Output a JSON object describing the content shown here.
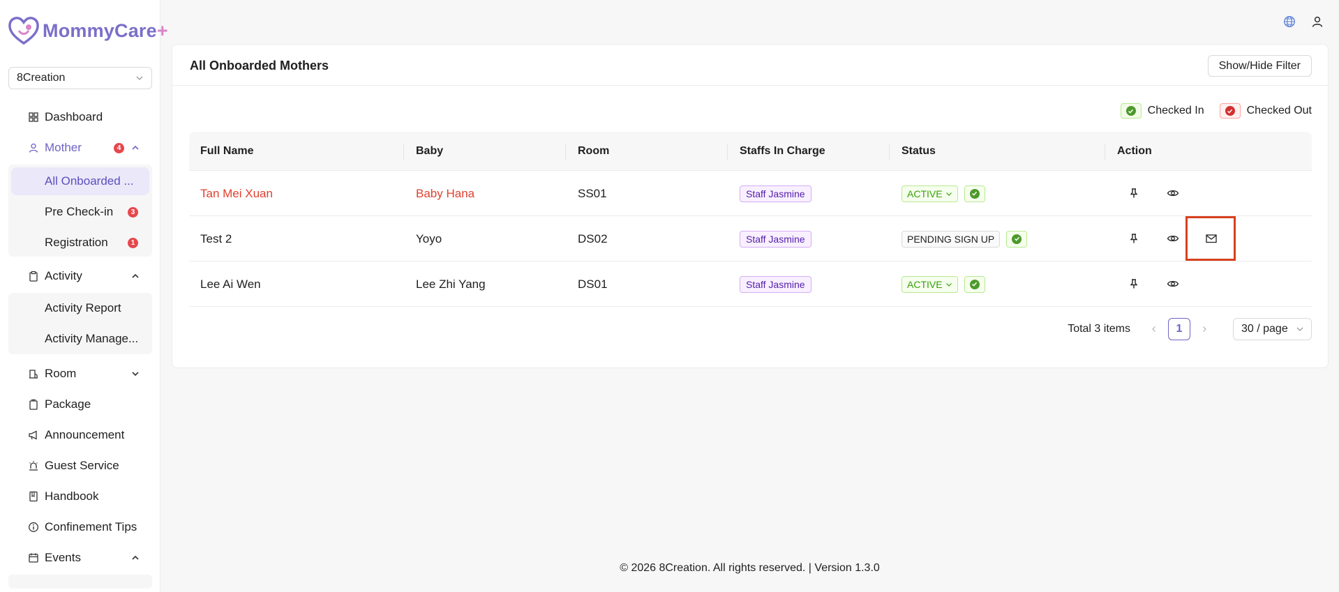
{
  "app": {
    "name": "MommyCare",
    "name_suffix": "+",
    "accent": "#6f64c4"
  },
  "org_select": {
    "value": "8Creation"
  },
  "sidebar": {
    "dashboard": "Dashboard",
    "mother": {
      "label": "Mother",
      "badge": "4"
    },
    "mother_items": [
      {
        "label": "All Onboarded ...",
        "badge": ""
      },
      {
        "label": "Pre Check-in",
        "badge": "3"
      },
      {
        "label": "Registration",
        "badge": "1"
      }
    ],
    "activity": {
      "label": "Activity"
    },
    "activity_items": [
      {
        "label": "Activity Report"
      },
      {
        "label": "Activity Manage..."
      }
    ],
    "room": "Room",
    "package": "Package",
    "announcement": "Announcement",
    "guest_service": "Guest Service",
    "handbook": "Handbook",
    "confinement_tips": "Confinement Tips",
    "events": "Events"
  },
  "card": {
    "title": "All Onboarded Mothers",
    "filter_button": "Show/Hide Filter",
    "legend": {
      "checked_in": "Checked In",
      "checked_out": "Checked Out"
    }
  },
  "table": {
    "columns": [
      "Full Name",
      "Baby",
      "Room",
      "Staffs In Charge",
      "Status",
      "Action"
    ],
    "rows": [
      {
        "name": "Tan Mei Xuan",
        "baby": "Baby Hana",
        "room": "SS01",
        "staff": "Staff Jasmine",
        "status": "ACTIVE"
      },
      {
        "name": "Test 2",
        "baby": "Yoyo",
        "room": "DS02",
        "staff": "Staff Jasmine",
        "status": "PENDING SIGN UP"
      },
      {
        "name": "Lee Ai Wen",
        "baby": "Lee Zhi Yang",
        "room": "DS01",
        "staff": "Staff Jasmine",
        "status": "ACTIVE"
      }
    ]
  },
  "pagination": {
    "total": "Total 3 items",
    "current_page": "1",
    "page_size": "30 / page"
  },
  "footer": "© 2026 8Creation. All rights reserved. | Version 1.3.0"
}
